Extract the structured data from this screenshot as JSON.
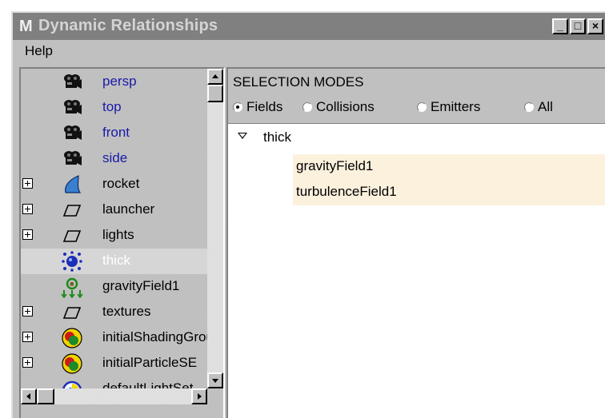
{
  "window": {
    "title": "Dynamic Relationships",
    "icon_letter": "M",
    "buttons": [
      "_",
      "□",
      "×"
    ]
  },
  "menubar": {
    "help": "Help"
  },
  "outliner": {
    "items": [
      {
        "label": "persp",
        "icon": "camera-icon",
        "expandable": false,
        "camera": true
      },
      {
        "label": "top",
        "icon": "camera-icon",
        "expandable": false,
        "camera": true
      },
      {
        "label": "front",
        "icon": "camera-icon",
        "expandable": false,
        "camera": true
      },
      {
        "label": "side",
        "icon": "camera-icon",
        "expandable": false,
        "camera": true
      },
      {
        "label": "rocket",
        "icon": "nurbs-surface-icon",
        "expandable": true
      },
      {
        "label": "launcher",
        "icon": "transform-icon",
        "expandable": true
      },
      {
        "label": "lights",
        "icon": "transform-icon",
        "expandable": true
      },
      {
        "label": "thick",
        "icon": "particle-icon",
        "expandable": false,
        "selected": true
      },
      {
        "label": "gravityField1",
        "icon": "gravity-field-icon",
        "expandable": false
      },
      {
        "label": "textures",
        "icon": "transform-icon",
        "expandable": true
      },
      {
        "label": "initialShadingGroup",
        "icon": "shading-group-icon",
        "expandable": true
      },
      {
        "label": "initialParticleSE",
        "icon": "shading-group-icon",
        "expandable": true
      },
      {
        "label": "defaultLightSet",
        "icon": "light-set-icon",
        "expandable": false
      }
    ]
  },
  "selection_modes": {
    "title": "SELECTION MODES",
    "options": [
      {
        "label": "Fields",
        "checked": true
      },
      {
        "label": "Collisions",
        "checked": false
      },
      {
        "label": "Emitters",
        "checked": false
      },
      {
        "label": "All",
        "checked": false
      }
    ]
  },
  "tree": {
    "parent": "thick",
    "children": [
      "gravityField1",
      "turbulenceField1"
    ]
  },
  "colors": {
    "titlebar": "#808080",
    "panel": "#c0c0c0",
    "camera_label": "#1a1aa8",
    "child_highlight": "#fbf1dd",
    "selected_row": "#d6d6d6"
  }
}
